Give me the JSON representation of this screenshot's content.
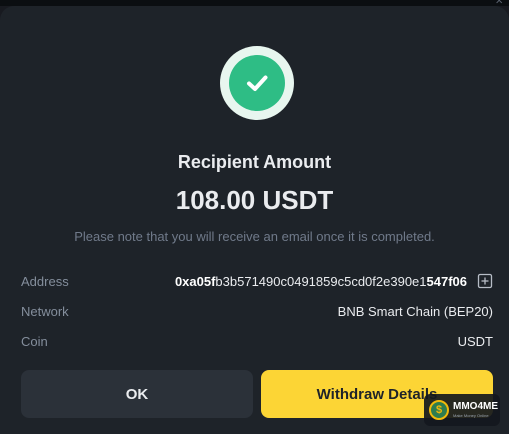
{
  "modal": {
    "title": "Recipient Amount",
    "amount": "108.00 USDT",
    "note": "Please note that you will receive an email once it is completed.",
    "status_icon": "check-circle-icon",
    "accent_color": "#2ebd85"
  },
  "details": {
    "address_label": "Address",
    "address_prefix": "0xa05f",
    "address_middle": "b3b571490c0491859c5cd0f2e390e1",
    "address_suffix": "547f06",
    "network_label": "Network",
    "network_value": "BNB Smart Chain (BEP20)",
    "coin_label": "Coin",
    "coin_value": "USDT"
  },
  "buttons": {
    "ok_label": "OK",
    "withdraw_label": "Withdraw Details",
    "primary_color": "#fcd535"
  },
  "watermark": {
    "name": "MMO4ME",
    "sub": "Make Money Online",
    "coin_glyph": "$"
  }
}
